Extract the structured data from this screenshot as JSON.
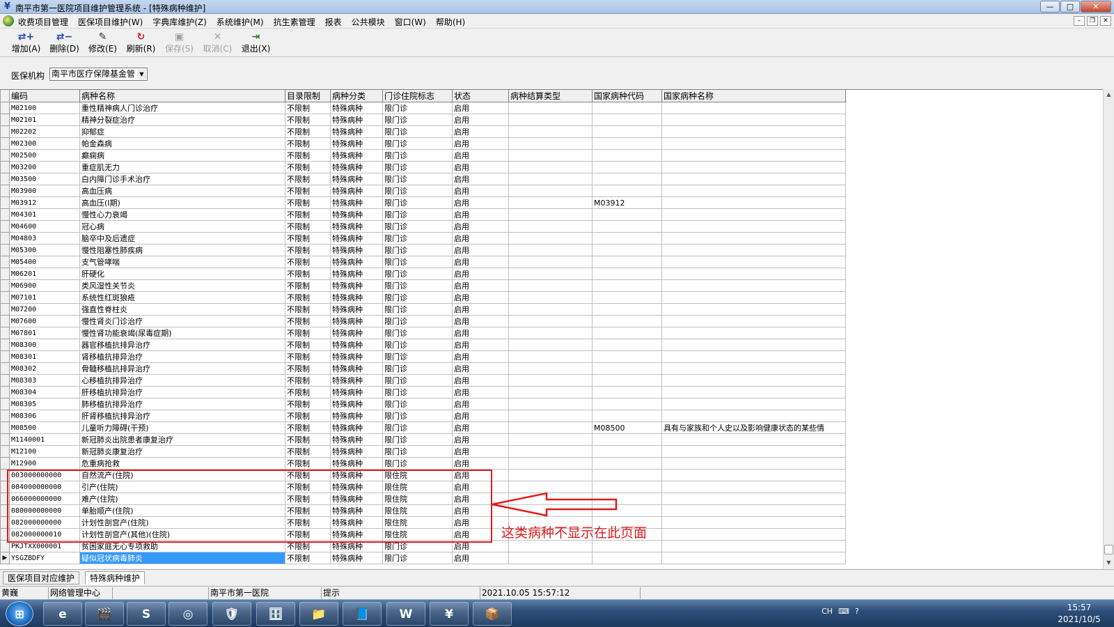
{
  "window": {
    "title": "南平市第一医院项目维护管理系统 - [特殊病种维护]",
    "controls": [
      "—",
      "□",
      "✕"
    ]
  },
  "menubar": {
    "items": [
      "收费项目管理",
      "医保项目维护(W)",
      "字典库维护(Z)",
      "系统维护(M)",
      "抗生素管理",
      "报表",
      "公共模块",
      "窗口(W)",
      "帮助(H)"
    ],
    "mdi_controls": [
      "–",
      "❐",
      "✕"
    ]
  },
  "toolbar": {
    "add": "增加(A)",
    "delete": "删除(D)",
    "edit": "修改(E)",
    "refresh": "刷新(R)",
    "save": "保存(S)",
    "cancel": "取消(C)",
    "exit": "退出(X)"
  },
  "filter": {
    "label": "医保机构",
    "value": "南平市医疗保障基金管"
  },
  "grid": {
    "columns": [
      "编码",
      "病种名称",
      "目录限制",
      "病种分类",
      "门诊住院标志",
      "状态",
      "病种结算类型",
      "国家病种代码",
      "国家病种名称"
    ],
    "rows": [
      [
        "M02100",
        "重性精神病人门诊治疗",
        "不限制",
        "特殊病种",
        "限门诊",
        "启用",
        "",
        "",
        ""
      ],
      [
        "M02101",
        "精神分裂症治疗",
        "不限制",
        "特殊病种",
        "限门诊",
        "启用",
        "",
        "",
        ""
      ],
      [
        "M02202",
        "抑郁症",
        "不限制",
        "特殊病种",
        "限门诊",
        "启用",
        "",
        "",
        ""
      ],
      [
        "M02300",
        "帕金森病",
        "不限制",
        "特殊病种",
        "限门诊",
        "启用",
        "",
        "",
        ""
      ],
      [
        "M02500",
        "癫痫病",
        "不限制",
        "特殊病种",
        "限门诊",
        "启用",
        "",
        "",
        ""
      ],
      [
        "M03200",
        "重症肌无力",
        "不限制",
        "特殊病种",
        "限门诊",
        "启用",
        "",
        "",
        ""
      ],
      [
        "M03500",
        "白内障门诊手术治疗",
        "不限制",
        "特殊病种",
        "限门诊",
        "启用",
        "",
        "",
        ""
      ],
      [
        "M03900",
        "高血压病",
        "不限制",
        "特殊病种",
        "限门诊",
        "启用",
        "",
        "",
        ""
      ],
      [
        "M03912",
        "高血压(Ⅰ期)",
        "不限制",
        "特殊病种",
        "限门诊",
        "启用",
        "",
        "M03912",
        ""
      ],
      [
        "M04301",
        "慢性心力衰竭",
        "不限制",
        "特殊病种",
        "限门诊",
        "启用",
        "",
        "",
        ""
      ],
      [
        "M04600",
        "冠心病",
        "不限制",
        "特殊病种",
        "限门诊",
        "启用",
        "",
        "",
        ""
      ],
      [
        "M04803",
        "脑卒中及后遗症",
        "不限制",
        "特殊病种",
        "限门诊",
        "启用",
        "",
        "",
        ""
      ],
      [
        "M05300",
        "慢性阻塞性肺疾病",
        "不限制",
        "特殊病种",
        "限门诊",
        "启用",
        "",
        "",
        ""
      ],
      [
        "M05400",
        "支气管哮喘",
        "不限制",
        "特殊病种",
        "限门诊",
        "启用",
        "",
        "",
        ""
      ],
      [
        "M06201",
        "肝硬化",
        "不限制",
        "特殊病种",
        "限门诊",
        "启用",
        "",
        "",
        ""
      ],
      [
        "M06900",
        "类风湿性关节炎",
        "不限制",
        "特殊病种",
        "限门诊",
        "启用",
        "",
        "",
        ""
      ],
      [
        "M07101",
        "系统性红斑狼疮",
        "不限制",
        "特殊病种",
        "限门诊",
        "启用",
        "",
        "",
        ""
      ],
      [
        "M07200",
        "强直性脊柱炎",
        "不限制",
        "特殊病种",
        "限门诊",
        "启用",
        "",
        "",
        ""
      ],
      [
        "M07600",
        "慢性肾炎门诊治疗",
        "不限制",
        "特殊病种",
        "限门诊",
        "启用",
        "",
        "",
        ""
      ],
      [
        "M07801",
        "慢性肾功能衰竭(尿毒症期)",
        "不限制",
        "特殊病种",
        "限门诊",
        "启用",
        "",
        "",
        ""
      ],
      [
        "M08300",
        "器官移植抗排异治疗",
        "不限制",
        "特殊病种",
        "限门诊",
        "启用",
        "",
        "",
        ""
      ],
      [
        "M08301",
        "肾移植抗排异治疗",
        "不限制",
        "特殊病种",
        "限门诊",
        "启用",
        "",
        "",
        ""
      ],
      [
        "M08302",
        "骨髓移植抗排异治疗",
        "不限制",
        "特殊病种",
        "限门诊",
        "启用",
        "",
        "",
        ""
      ],
      [
        "M08303",
        "心移植抗排异治疗",
        "不限制",
        "特殊病种",
        "限门诊",
        "启用",
        "",
        "",
        ""
      ],
      [
        "M08304",
        "肝移植抗排异治疗",
        "不限制",
        "特殊病种",
        "限门诊",
        "启用",
        "",
        "",
        ""
      ],
      [
        "M08305",
        "肺移植抗排异治疗",
        "不限制",
        "特殊病种",
        "限门诊",
        "启用",
        "",
        "",
        ""
      ],
      [
        "M08306",
        "肝肾移植抗排异治疗",
        "不限制",
        "特殊病种",
        "限门诊",
        "启用",
        "",
        "",
        ""
      ],
      [
        "M08500",
        "儿童听力障碍(干预)",
        "不限制",
        "特殊病种",
        "限门诊",
        "启用",
        "",
        "M08500",
        "具有与家族和个人史以及影响健康状态的某些情"
      ],
      [
        "M1140001",
        "新冠肺炎出院患者康复治疗",
        "不限制",
        "特殊病种",
        "限门诊",
        "启用",
        "",
        "",
        ""
      ],
      [
        "M12100",
        "新冠肺炎康复治疗",
        "不限制",
        "特殊病种",
        "限门诊",
        "启用",
        "",
        "",
        ""
      ],
      [
        "M12900",
        "危重病抢救",
        "不限制",
        "特殊病种",
        "限门诊",
        "启用",
        "",
        "",
        ""
      ],
      [
        "003000000000",
        "自然流产(住院)",
        "不限制",
        "特殊病种",
        "限住院",
        "启用",
        "",
        "",
        ""
      ],
      [
        "004000000000",
        "引产(住院)",
        "不限制",
        "特殊病种",
        "限住院",
        "启用",
        "",
        "",
        ""
      ],
      [
        "066000000000",
        "难产(住院)",
        "不限制",
        "特殊病种",
        "限住院",
        "启用",
        "",
        "",
        ""
      ],
      [
        "080000000000",
        "单胎顺产(住院)",
        "不限制",
        "特殊病种",
        "限住院",
        "启用",
        "",
        "",
        ""
      ],
      [
        "082000000000",
        "计划性剖宫产(住院)",
        "不限制",
        "特殊病种",
        "限住院",
        "启用",
        "",
        "",
        ""
      ],
      [
        "082000000010",
        "计划性剖宫产(其他)(住院)",
        "不限制",
        "特殊病种",
        "限住院",
        "启用",
        "",
        "",
        ""
      ],
      [
        "PKJTXX000001",
        "贫困家庭无心专项救助",
        "不限制",
        "特殊病种",
        "限门诊",
        "启用",
        "",
        "",
        ""
      ],
      [
        "YSGZBDFY",
        "疑似冠状病毒肺炎",
        "不限制",
        "特殊病种",
        "限门诊",
        "启用",
        "",
        "",
        ""
      ]
    ],
    "selected_row_index": 38
  },
  "annotation": {
    "text": "这类病种不显示在此页面",
    "color": "#e01b1b"
  },
  "tabs": [
    "医保项目对应维护",
    "特殊病种维护"
  ],
  "active_tab": "特殊病种维护",
  "statusbar": {
    "user": "黄巍",
    "dept": "网络管理中心",
    "hospital": "南平市第一医院",
    "hint": "提示",
    "datetime": "2021.10.05   15:57:12"
  },
  "taskbar": {
    "apps": [
      "e",
      "🎬",
      "S",
      "◎",
      "🛡",
      "🗄",
      "📁",
      "📘",
      "W",
      "¥",
      "📦"
    ],
    "tray": [
      "CH",
      "⌨",
      "?"
    ],
    "time": "15:57",
    "date": "2021/10/5"
  },
  "colors": {
    "selection": "#3399ff",
    "annotation": "#e01b1b",
    "taskbar": "#2d4f79"
  }
}
